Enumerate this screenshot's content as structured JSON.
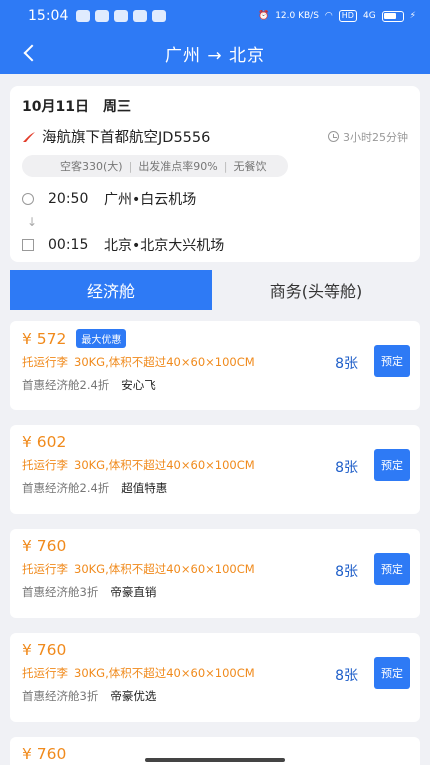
{
  "status_bar": {
    "time": "15:04",
    "speed": "12.0 KB/S",
    "hd": "HD",
    "signal": "4G"
  },
  "header": {
    "title": "广州 → 北京"
  },
  "flight": {
    "date": "10月11日",
    "weekday": "周三",
    "airline": "海航旗下首都航空JD5556",
    "duration": "3小时25分钟",
    "info": [
      "空客330(大)",
      "出发准点率90%",
      "无餐饮"
    ],
    "departure": {
      "time": "20:50",
      "airport": "广州•白云机场"
    },
    "connector": "↓",
    "arrival": {
      "time": "00:15",
      "airport": "北京•北京大兴机场"
    }
  },
  "tabs": [
    {
      "label": "经济舱",
      "active": true
    },
    {
      "label": "商务(头等舱)",
      "active": false
    }
  ],
  "fares": [
    {
      "price": "¥ 572",
      "badge": "最大优惠",
      "baggage_label": "托运行李",
      "baggage_detail": "30KG,体积不超过40×60×100CM",
      "discount": "首惠经济舱2.4折",
      "tag": "安心飞",
      "seats": "8张",
      "book": "预定"
    },
    {
      "price": "¥ 602",
      "badge": "",
      "baggage_label": "托运行李",
      "baggage_detail": "30KG,体积不超过40×60×100CM",
      "discount": "首惠经济舱2.4折",
      "tag": "超值特惠",
      "seats": "8张",
      "book": "预定"
    },
    {
      "price": "¥ 760",
      "badge": "",
      "baggage_label": "托运行李",
      "baggage_detail": "30KG,体积不超过40×60×100CM",
      "discount": "首惠经济舱3折",
      "tag": "帝豪直销",
      "seats": "8张",
      "book": "预定"
    },
    {
      "price": "¥ 760",
      "badge": "",
      "baggage_label": "托运行李",
      "baggage_detail": "30KG,体积不超过40×60×100CM",
      "discount": "首惠经济舱3折",
      "tag": "帝豪优选",
      "seats": "8张",
      "book": "预定"
    },
    {
      "price": "¥ 760"
    }
  ],
  "colors": {
    "primary": "#2e7af5",
    "price": "#f08a1c",
    "seats": "#1f5fc9",
    "background": "#f0f1f5"
  }
}
